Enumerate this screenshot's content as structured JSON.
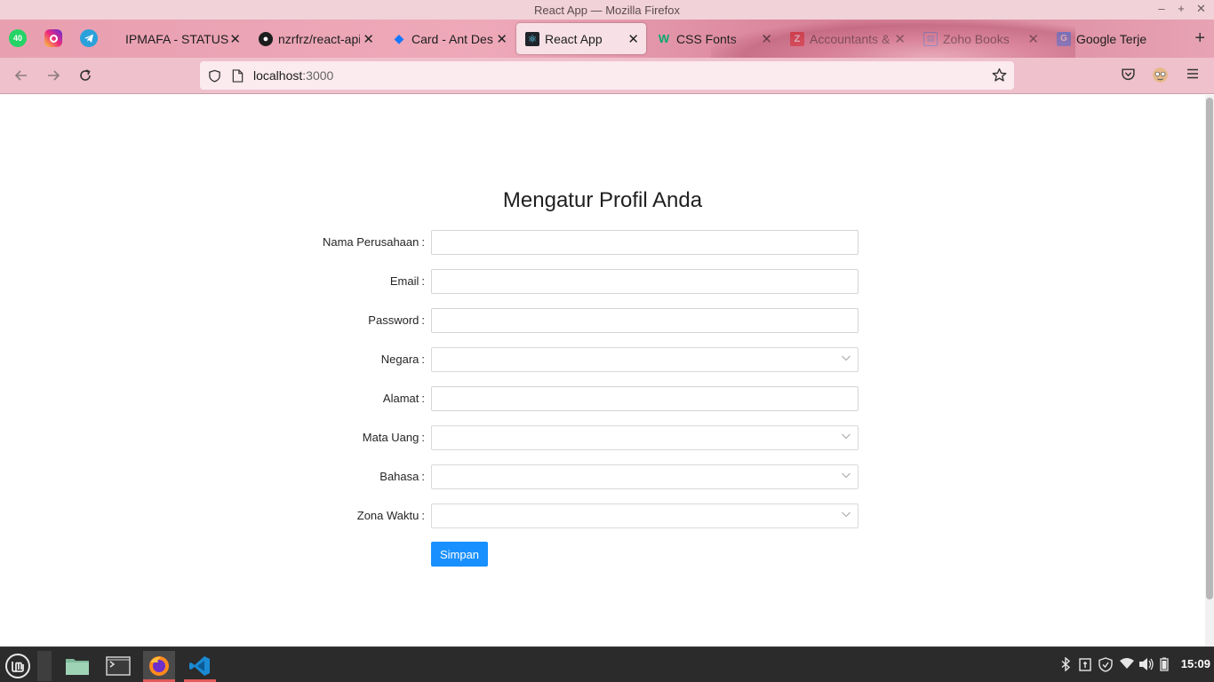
{
  "window": {
    "title": "React App — Mozilla Firefox",
    "controls": [
      "–",
      "+",
      "✕"
    ]
  },
  "tabs": {
    "pinned": [
      {
        "name": "whatsapp",
        "badge": "40",
        "color": "#25d366"
      },
      {
        "name": "instagram",
        "badge": "",
        "color": "#d6249f"
      },
      {
        "name": "telegram",
        "badge": "",
        "color": "#2aa1da"
      }
    ],
    "items": [
      {
        "label": "IPMAFA - STATUS",
        "icon": "none",
        "close": "✕"
      },
      {
        "label": "nzrfrz/react-api",
        "icon": "github-icon",
        "close": "✕"
      },
      {
        "label": "Card - Ant Desi",
        "icon": "ant-design-icon",
        "close": "✕"
      },
      {
        "label": "React App",
        "icon": "react-icon",
        "close": "✕"
      },
      {
        "label": "CSS Fonts",
        "icon": "w3schools-icon",
        "close": "✕"
      },
      {
        "label": "Accountants &",
        "icon": "zoho-icon",
        "close": "✕"
      },
      {
        "label": "Zoho Books",
        "icon": "zoho-books-icon",
        "close": "✕"
      },
      {
        "label": "Google Terjem",
        "icon": "google-translate-icon",
        "close": "✕"
      }
    ],
    "new_tab": "+"
  },
  "navbar": {
    "url_host": "localhost",
    "url_port": ":3000"
  },
  "form": {
    "title": "Mengatur Profil Anda",
    "fields": [
      {
        "label": "Nama Perusahaan",
        "type": "text",
        "value": ""
      },
      {
        "label": "Email",
        "type": "text",
        "value": ""
      },
      {
        "label": "Password",
        "type": "password",
        "value": ""
      },
      {
        "label": "Negara",
        "type": "select",
        "value": ""
      },
      {
        "label": "Alamat",
        "type": "text",
        "value": ""
      },
      {
        "label": "Mata Uang",
        "type": "select",
        "value": ""
      },
      {
        "label": "Bahasa",
        "type": "select",
        "value": ""
      },
      {
        "label": "Zona Waktu",
        "type": "select",
        "value": ""
      }
    ],
    "colon": ":",
    "submit_label": "Simpan",
    "submit_color": "#1890ff"
  },
  "taskbar": {
    "clock": "15:09"
  }
}
